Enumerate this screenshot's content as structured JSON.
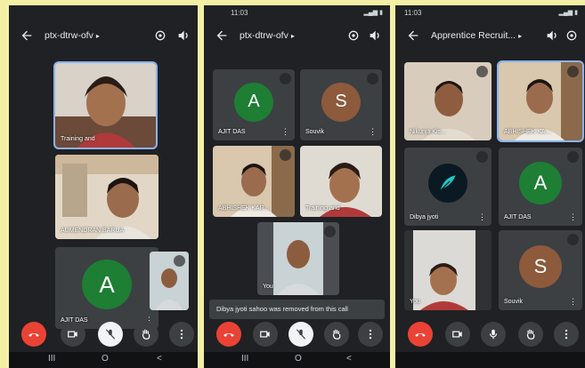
{
  "colors": {
    "background": "#f3f0a6",
    "app_bg": "#202124",
    "tile_bg": "#3c4043",
    "end_call": "#ea4335",
    "active_border": "#8ab4f8"
  },
  "phone1": {
    "title": "ptx-dtrw-ofv",
    "caret": "▸",
    "tiles": {
      "t1": "Training and",
      "t2": "AUMENDRAN BARUA",
      "t3": "AJIT DAS"
    },
    "avatars": {
      "a1": "A"
    },
    "self_label": ""
  },
  "phone2": {
    "status_time": "11:03",
    "title": "ptx-dtrw-ofv",
    "caret": "▸",
    "tiles": {
      "t1": "AJIT DAS",
      "t2": "Souvik",
      "t3": "ABHISHEK KAR...",
      "t4": "Training and",
      "t5": "You"
    },
    "avatars": {
      "a1": "A",
      "a2": "S"
    },
    "toast": "Dibya jyoti sahoo was removed from this call"
  },
  "phone3": {
    "status_time": "11:03",
    "title": "Apprentice Recruit...",
    "caret": "▸",
    "tiles": {
      "t1": "Nikunja Kis...",
      "t2": "ABHISHEK KA...",
      "t3": "Dibya jyoti",
      "t4": "AJIT DAS",
      "t5": "You",
      "t6": "Souvik"
    },
    "avatars": {
      "a1": "A",
      "a2": "S"
    }
  },
  "navbar": {
    "recents": "III",
    "home": "O",
    "back": "<"
  },
  "icons": [
    "back-arrow-icon",
    "switch-camera-icon",
    "speaker-icon",
    "mic-off-icon",
    "end-call-icon",
    "camera-icon",
    "raise-hand-icon",
    "more-options-icon",
    "mic-icon",
    "feather-icon"
  ]
}
